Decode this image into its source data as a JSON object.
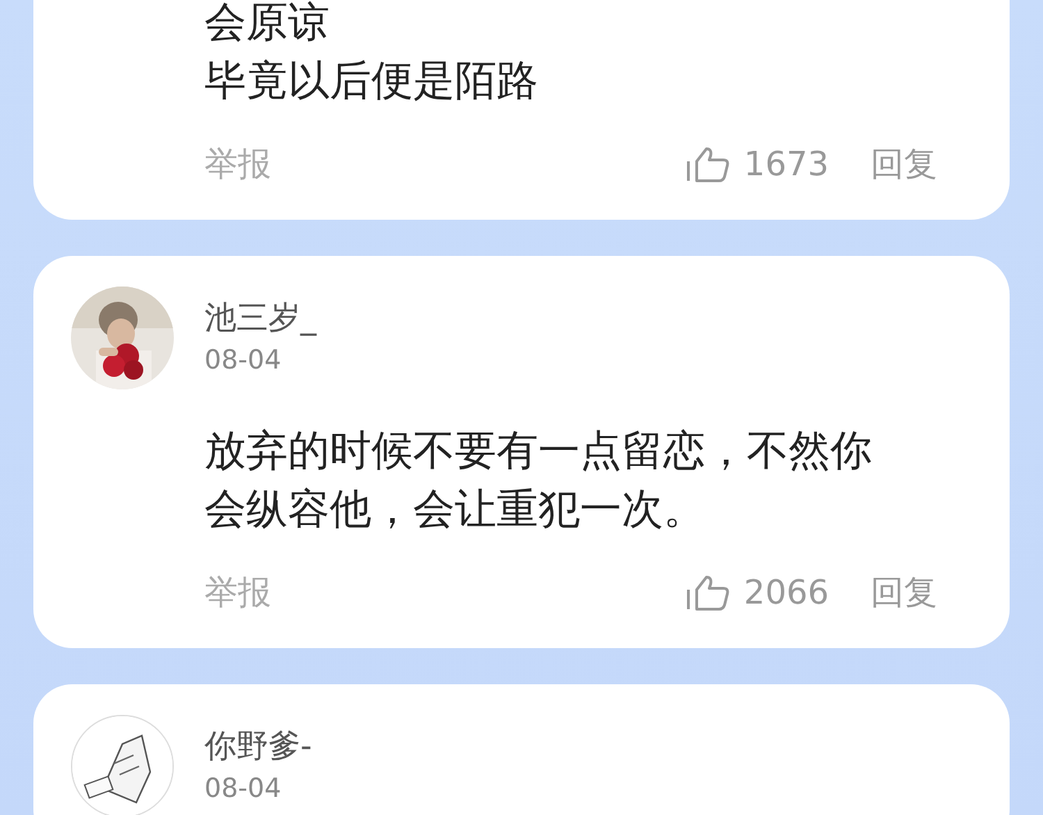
{
  "comments": [
    {
      "lines": [
        "会原谅",
        "毕竟以后便是陌路"
      ],
      "report": "举报",
      "likes": "1673",
      "reply": "回复"
    },
    {
      "user": "池三岁_",
      "date": "08-04",
      "avatar": {
        "kind": "picture"
      },
      "lines": [
        "放弃的时候不要有一点留恋，不然你",
        "会纵容他，会让重犯一次。"
      ],
      "report": "举报",
      "likes": "2066",
      "reply": "回复"
    },
    {
      "user": "你野爹-",
      "date": "08-04",
      "avatar": {
        "kind": "picture"
      }
    }
  ]
}
